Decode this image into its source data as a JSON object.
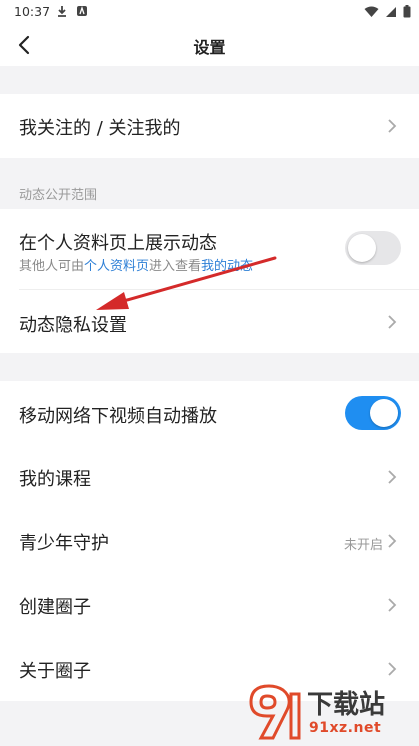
{
  "status_bar": {
    "time": "10:37"
  },
  "header": {
    "title": "设置"
  },
  "settings": {
    "follow_label": "我关注的 / 关注我的",
    "section_dynamic": "动态公开范围",
    "show_dynamic_label": "在个人资料页上展示动态",
    "show_dynamic_sub_prefix": "其他人可由",
    "show_dynamic_sub_link1": "个人资料页",
    "show_dynamic_sub_mid": "进入查看",
    "show_dynamic_sub_link2": "我的动态",
    "show_dynamic_enabled": false,
    "dynamic_privacy_label": "动态隐私设置",
    "autoplay_label": "移动网络下视频自动播放",
    "autoplay_enabled": true,
    "my_courses_label": "我的课程",
    "youth_label": "青少年守护",
    "youth_value": "未开启",
    "create_circle_label": "创建圈子",
    "about_circle_label": "关于圈子"
  },
  "watermark": {
    "text": "下载站",
    "sub": "91xz.net"
  },
  "colors": {
    "accent": "#1f8ef1",
    "link": "#2d7fd6",
    "annotation_arrow": "#d42a2a"
  }
}
